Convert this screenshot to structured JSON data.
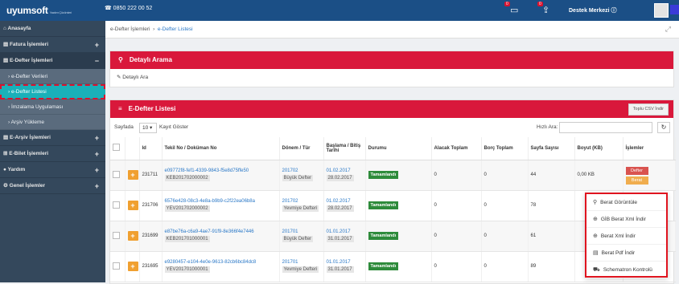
{
  "topbar": {
    "logo": "uyumsoft",
    "logo_tagline": "Yazılım Çözümleri",
    "phone": "0850 222 00 52",
    "badge1": "0",
    "badge2": "0",
    "help": "Destek Merkezi ⓘ"
  },
  "sidebar": {
    "items": [
      {
        "label": "Anasayfa",
        "icon": "home-icon"
      },
      {
        "label": "Fatura İşlemleri",
        "icon": "file-icon"
      },
      {
        "label": "E-Defter İşlemleri",
        "icon": "book-icon"
      },
      {
        "label": "e-Defter Verileri"
      },
      {
        "label": "e-Defter Listesi"
      },
      {
        "label": "İmzalama Uygulaması"
      },
      {
        "label": "Arşiv Yükleme"
      },
      {
        "label": "E-Arşiv İşlemleri",
        "icon": "archive-icon"
      },
      {
        "label": "E-Bilet İşlemleri",
        "icon": "ticket-icon"
      },
      {
        "label": "Yardım",
        "icon": "help-icon"
      },
      {
        "label": "Genel İşlemler",
        "icon": "settings-icon"
      }
    ]
  },
  "breadcrumb": {
    "parent": "e-Defter İşlemleri",
    "current": "e-Defter Listesi"
  },
  "search_panel": {
    "title": "Detaylı Arama",
    "link": "Detaylı Ara"
  },
  "list_panel": {
    "title": "E-Defter Listesi",
    "csv_button": "Toplu CSV İndir",
    "page_label": "Sayfada",
    "page_size": "10",
    "records_label": "Kayıt Göster",
    "search_label": "Hızlı Ara:"
  },
  "table": {
    "headers": [
      "",
      "",
      "Id",
      "Tekil No / Doküman No",
      "Dönem / Tür",
      "Başlama / Bitiş Tarihi",
      "Durumu",
      "Alacak Toplam",
      "Borç Toplam",
      "Sayfa Sayısı",
      "Boyut (KB)",
      "İşlemler"
    ],
    "rows": [
      {
        "id": "231711",
        "uuid": "e09772f8-fef1-4339-9843-f5e8d75ffe50",
        "doc": "KEB201702000002",
        "period": "201702",
        "type": "Büyük Defter",
        "start": "01.02.2017",
        "end": "28.02.2017",
        "status": "Tamamlandı",
        "credit": "0",
        "debit": "0",
        "pages": "44",
        "size": "0,00 KB"
      },
      {
        "id": "231706",
        "uuid": "6576e428-08c3-4e8a-b9b9-c2f22ea06b8a",
        "doc": "YEV201702000002",
        "period": "201702",
        "type": "Yevmiye Defteri",
        "start": "01.02.2017",
        "end": "28.02.2017",
        "status": "Tamamlandı",
        "credit": "0",
        "debit": "0",
        "pages": "78",
        "size": ""
      },
      {
        "id": "231699",
        "uuid": "e87be76a-c6a9-4ae7-91f9-8e366f4e7446",
        "doc": "KEB201701000001",
        "period": "201701",
        "type": "Büyük Defter",
        "start": "01.01.2017",
        "end": "31.01.2017",
        "status": "Tamamlandı",
        "credit": "0",
        "debit": "0",
        "pages": "61",
        "size": ""
      },
      {
        "id": "231695",
        "uuid": "e9280457-e104-4e0e-9613-82cb6bc84dc8",
        "doc": "YEV201701000001",
        "period": "201701",
        "type": "Yevmiye Defteri",
        "start": "01.01.2017",
        "end": "31.01.2017",
        "status": "Tamamlandı",
        "credit": "0",
        "debit": "0",
        "pages": "89",
        "size": ""
      }
    ],
    "action_defter": "Defter",
    "action_berat": "Berat"
  },
  "popup": {
    "items": [
      "Berat Görüntüle",
      "GİB Berat Xml İndir",
      "Berat Xml İndir",
      "Berat Pdf İndir",
      "Schematron Kontrolü"
    ]
  }
}
